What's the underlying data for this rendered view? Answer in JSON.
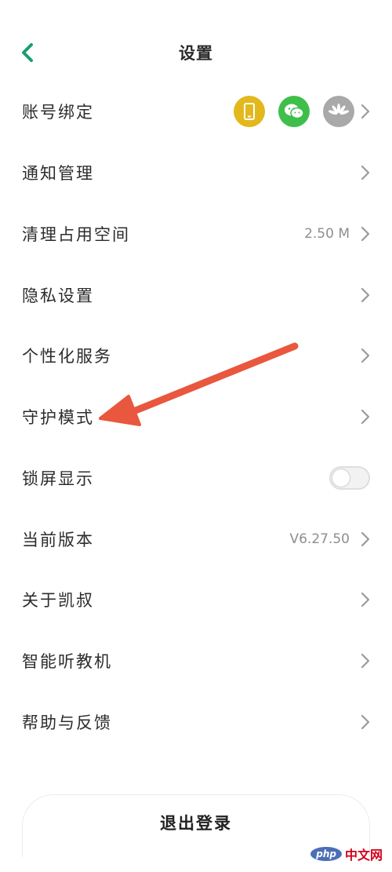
{
  "header": {
    "title": "设置"
  },
  "settings": {
    "account_binding": "账号绑定",
    "notifications": "通知管理",
    "clear_storage": "清理占用空间",
    "clear_storage_value": "2.50 M",
    "privacy": "隐私设置",
    "personalization": "个性化服务",
    "guardian_mode": "守护模式",
    "lock_screen": "锁屏显示",
    "lock_screen_enabled": false,
    "version": "当前版本",
    "version_value": "V6.27.50",
    "about": "关于凯叔",
    "smart_player": "智能听教机",
    "help": "帮助与反馈"
  },
  "binding_icons": [
    "phone-icon",
    "wechat-icon",
    "huawei-icon"
  ],
  "logout_label": "退出登录",
  "colors": {
    "accent": "#1a9e6f",
    "phone_bg": "#e2b81c",
    "wechat_bg": "#3fbf4a",
    "huawei_bg": "#a9a9a9",
    "annotation_arrow": "#e8573e"
  },
  "watermark": {
    "badge": "php",
    "text": "中文网"
  }
}
